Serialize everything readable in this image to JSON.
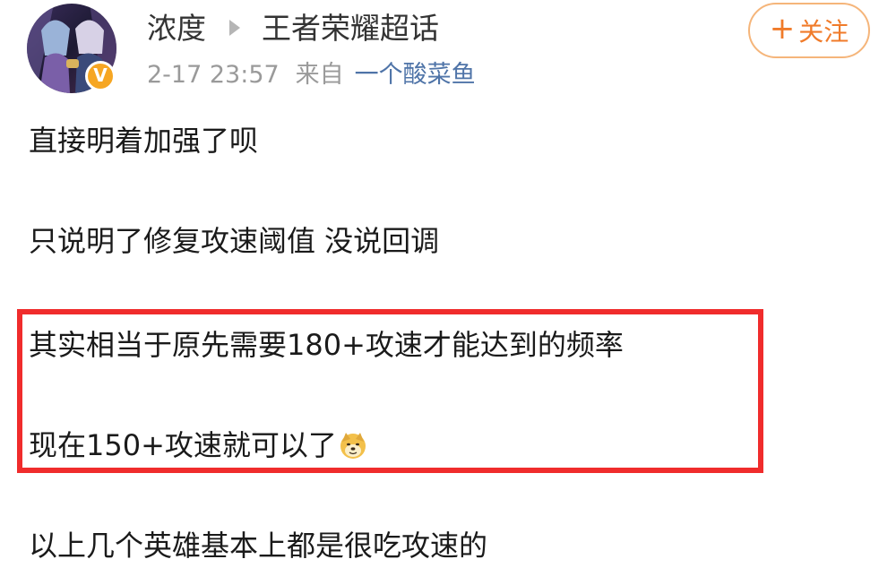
{
  "header": {
    "user_name": "浓度",
    "topic": "王者荣耀超话",
    "timestamp": "2-17 23:57",
    "from_label": "来自",
    "source": "一个酸菜鱼",
    "follow_label": "关注",
    "follow_plus": "+",
    "verified_badge": "V"
  },
  "post": {
    "lines": [
      "直接明着加强了呗",
      "只说明了修复攻速阈值 没说回调",
      "其实相当于原先需要180+攻速才能达到的频率",
      "现在150+攻速就可以了",
      "以上几个英雄基本上都是很吃攻速的"
    ],
    "emoji": "doge-emoji"
  },
  "colors": {
    "highlight_border": "#f02c2c",
    "follow_accent": "#f07b2a",
    "source_link": "#4f74a8",
    "verified_badge": "#f6a623"
  }
}
